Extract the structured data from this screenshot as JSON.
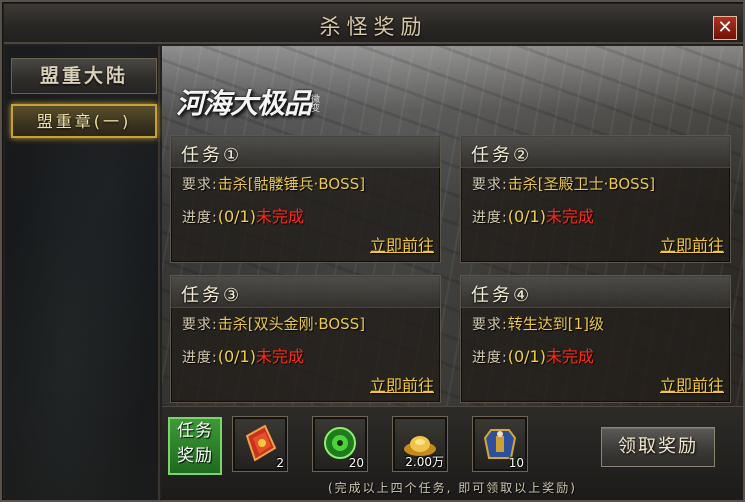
{
  "window": {
    "title": "杀怪奖励",
    "close_glyph": "✕"
  },
  "sidebar": {
    "items": [
      {
        "label": "盟重大陆",
        "active": false
      },
      {
        "label": "盟重章(一)",
        "active": true
      }
    ]
  },
  "banner": {
    "logo_text": "河海大极品",
    "logo_seal": "微变"
  },
  "tasks": [
    {
      "name": "任务①",
      "req_label": "要求:",
      "requirement": "击杀[骷髅锤兵·BOSS]",
      "progress_label": "进度:",
      "progress": "(0/1)",
      "status": "未完成",
      "go_label": "立即前往"
    },
    {
      "name": "任务②",
      "req_label": "要求:",
      "requirement": "击杀[圣殿卫士·BOSS]",
      "progress_label": "进度:",
      "progress": "(0/1)",
      "status": "未完成",
      "go_label": "立即前往"
    },
    {
      "name": "任务③",
      "req_label": "要求:",
      "requirement": "击杀[双头金刚·BOSS]",
      "progress_label": "进度:",
      "progress": "(0/1)",
      "status": "未完成",
      "go_label": "立即前往"
    },
    {
      "name": "任务④",
      "req_label": "要求:",
      "requirement": "转生达到[1]级",
      "progress_label": "进度:",
      "progress": "(0/1)",
      "status": "未完成",
      "go_label": "立即前往"
    }
  ],
  "rewards": {
    "label": "任务奖励",
    "items": [
      {
        "icon": "red-scroll-icon",
        "count": "2"
      },
      {
        "icon": "green-jade-icon",
        "count": "20"
      },
      {
        "icon": "gold-ingot-icon",
        "count": "2.00万"
      },
      {
        "icon": "armor-icon",
        "count": "10"
      }
    ],
    "claim_label": "领取奖励",
    "note": "(完成以上四个任务, 即可领取以上奖励)"
  },
  "colors": {
    "status_incomplete": "#ff2a1a",
    "progress": "#f3d13b",
    "link": "#f1c83c",
    "active_border": "#c9a233"
  }
}
